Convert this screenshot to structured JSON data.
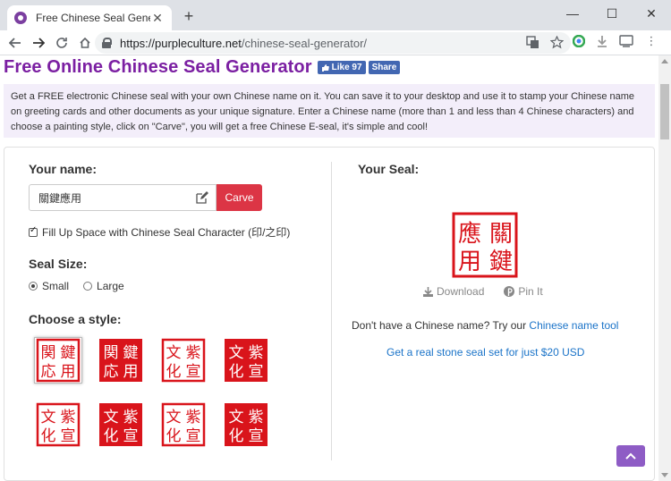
{
  "browser": {
    "tab_title": "Free Chinese Seal Generator",
    "tab_close": "✕",
    "new_tab": "+",
    "url_host": "https://purpleculture.net",
    "url_path": "/chinese-seal-generator/",
    "window_controls": [
      "—",
      "☐",
      "✕"
    ]
  },
  "page": {
    "title": "Free Online Chinese Seal Generator",
    "fb_like_label": "Like 97",
    "fb_share_label": "Share",
    "intro": "Get a FREE electronic Chinese seal with your own Chinese name on it. You can save it to your desktop and use it to stamp your Chinese name on greeting cards and other documents as your unique signature. Enter a Chinese name (more than 1 and less than 4 Chinese characters) and choose a painting style, click on \"Carve\", you will get a free Chinese E-seal, it's simple and cool!"
  },
  "form": {
    "name_label": "Your name:",
    "name_value": "關鍵應用",
    "carve_label": "Carve",
    "fill_label": "Fill Up Space with Chinese Seal Character (印/之印)",
    "fill_checked": true,
    "size_label": "Seal Size:",
    "size_options": [
      {
        "label": "Small",
        "selected": true
      },
      {
        "label": "Large",
        "selected": false
      }
    ],
    "style_label": "Choose a style:"
  },
  "styles": [
    {
      "chars": [
        "関",
        "鍵",
        "応",
        "用"
      ],
      "type": "inverse-border",
      "selected": true
    },
    {
      "chars": [
        "関",
        "鍵",
        "応",
        "用"
      ],
      "type": "solid"
    },
    {
      "chars": [
        "文",
        "紫",
        "化",
        "宣"
      ],
      "type": "outline"
    },
    {
      "chars": [
        "文",
        "紫",
        "化",
        "宣"
      ],
      "type": "solid"
    },
    {
      "chars": [
        "文",
        "紫",
        "化",
        "宣"
      ],
      "type": "outline"
    },
    {
      "chars": [
        "文",
        "紫",
        "化",
        "宣"
      ],
      "type": "solid"
    },
    {
      "chars": [
        "文",
        "紫",
        "化",
        "宣"
      ],
      "type": "outline"
    },
    {
      "chars": [
        "文",
        "紫",
        "化",
        "宣"
      ],
      "type": "solid"
    }
  ],
  "result": {
    "heading": "Your Seal:",
    "seal_chars": [
      "關",
      "鍵",
      "應",
      "用"
    ],
    "download_label": "Download",
    "pin_label": "Pin It",
    "name_tool_prefix": "Don't have a Chinese name? Try our ",
    "name_tool_link": "Chinese name tool",
    "stone_link": "Get a real stone seal set for just $20 USD"
  },
  "colors": {
    "seal_red": "#d9141b",
    "title_purple": "#7b1fa2",
    "carve_red": "#dc3545",
    "link_blue": "#1a73c8",
    "back_to_top": "#8e5cc5"
  },
  "icons": {
    "back_to_top": "^"
  }
}
